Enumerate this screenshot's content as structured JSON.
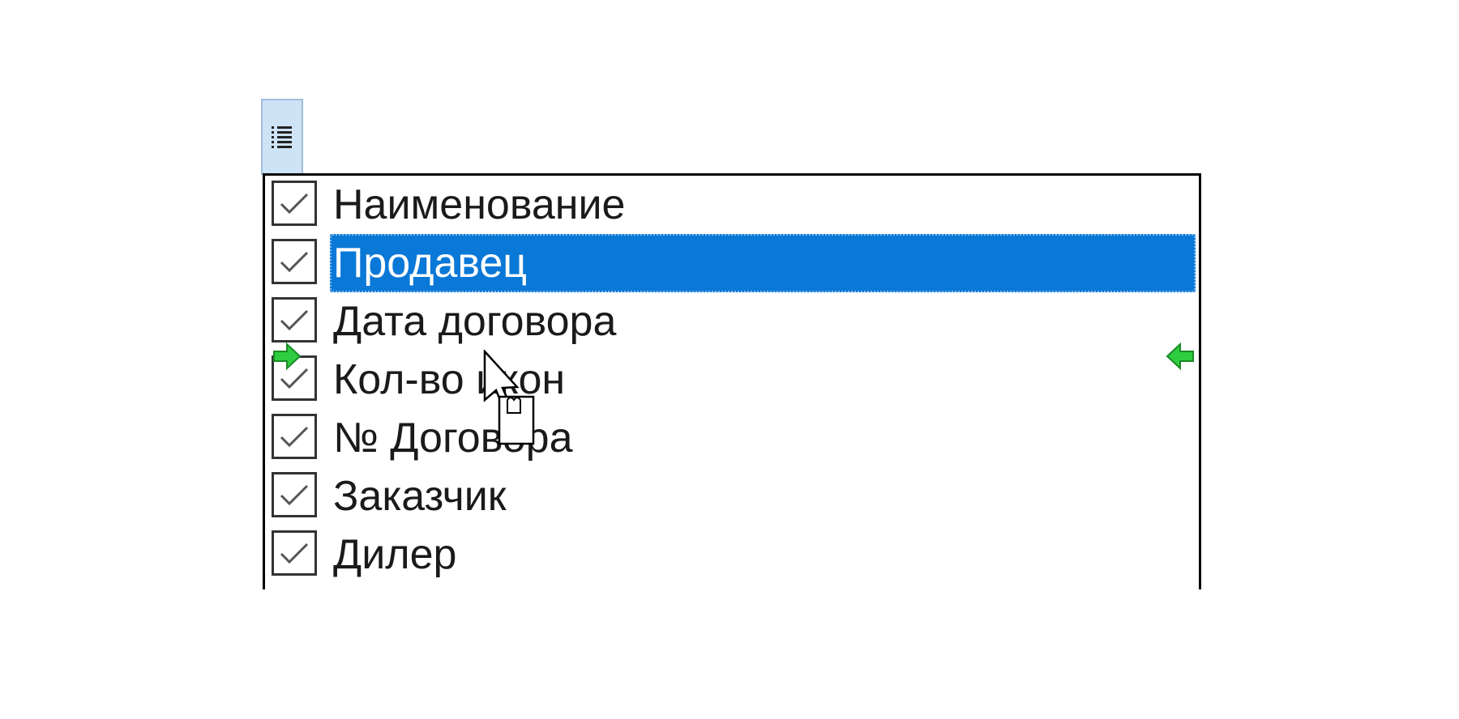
{
  "column_chooser": {
    "button_icon": "column-list-icon",
    "items": [
      {
        "label": "Наименование",
        "checked": true,
        "selected": false
      },
      {
        "label": "Продавец",
        "checked": true,
        "selected": true
      },
      {
        "label": "Дата договора",
        "checked": true,
        "selected": false
      },
      {
        "label": "Кол-во икон",
        "checked": true,
        "selected": false
      },
      {
        "label": "№ Договора",
        "checked": true,
        "selected": false
      },
      {
        "label": "Заказчик",
        "checked": true,
        "selected": false
      },
      {
        "label": "Дилер",
        "checked": true,
        "selected": false
      }
    ]
  },
  "colors": {
    "selection": "#0a78d7",
    "drop_indicator": "#2ecc40",
    "button_background": "#cfe3f6"
  },
  "icons": {
    "checkbox_mark": "check-icon",
    "drop_left": "drop-indicator-right-arrow-icon",
    "drop_right": "drop-indicator-left-arrow-icon",
    "cursor": "drag-cursor-icon"
  }
}
